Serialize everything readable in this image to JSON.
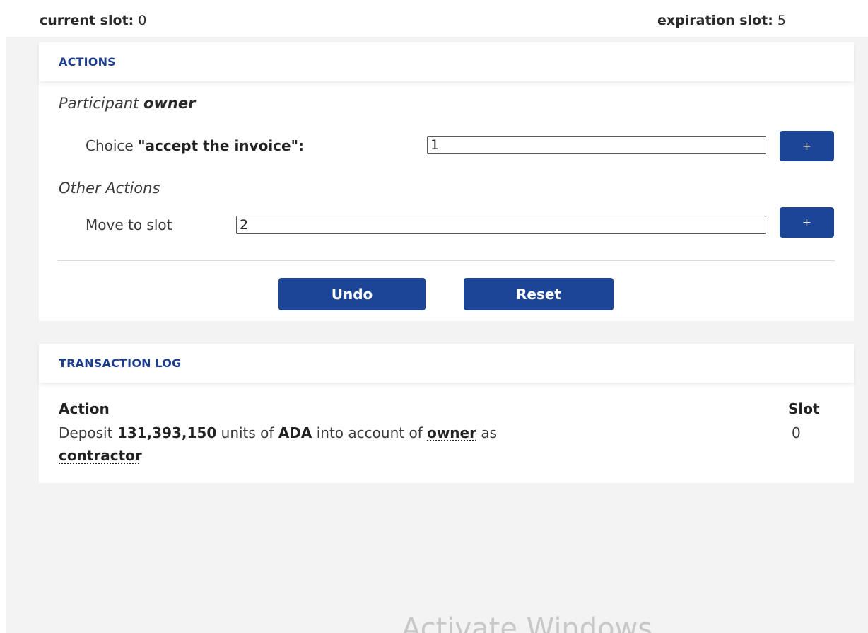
{
  "slots": {
    "current_label": "current slot:",
    "current_value": "0",
    "expiration_label": "expiration slot:",
    "expiration_value": "5"
  },
  "actions_panel": {
    "title": "ACTIONS",
    "participant_prefix": "Participant",
    "participant_name": "owner",
    "choice_prefix": "Choice",
    "choice_name": "\"accept the invoice\":",
    "choice_value": "1",
    "add_choice_label": "+",
    "other_actions_heading": "Other Actions",
    "move_to_slot_label": "Move to slot",
    "move_to_slot_value": "2",
    "add_move_label": "+",
    "undo_label": "Undo",
    "reset_label": "Reset"
  },
  "transaction_log": {
    "title": "TRANSACTION LOG",
    "columns": [
      "Action",
      "Slot"
    ],
    "entries": [
      {
        "verb": "Deposit",
        "amount": "131,393,150",
        "units_text": "units of",
        "token": "ADA",
        "into_text": "into account of",
        "account": "owner",
        "as_text": "as",
        "party": "contractor",
        "slot": "0"
      }
    ]
  },
  "overlay": {
    "watermark": "Activate Windows"
  },
  "colors": {
    "accent": "#1d4596",
    "title": "#1d3e8f",
    "background": "#f3f3f3"
  }
}
